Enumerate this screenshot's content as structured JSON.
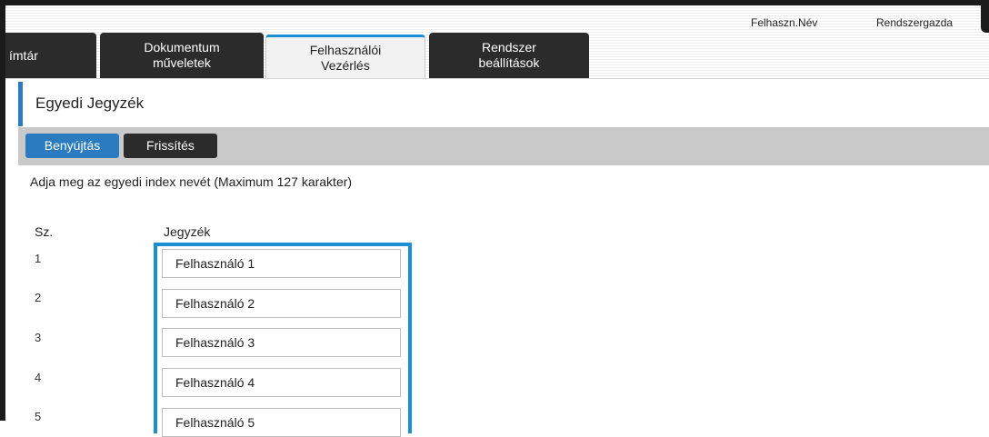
{
  "header": {
    "user_name_label": "Felhaszn.Név",
    "user_name_value": "Rendszergazda"
  },
  "tabs": [
    {
      "label_line1": "ímtár",
      "label_line2": ""
    },
    {
      "label_line1": "Dokumentum",
      "label_line2": "műveletek"
    },
    {
      "label_line1": "Felhasználói",
      "label_line2": "Vezérlés"
    },
    {
      "label_line1": "Rendszer",
      "label_line2": "beállítások"
    }
  ],
  "active_tab": "Felhasználói Vezérlés",
  "page": {
    "title": "Egyedi Jegyzék",
    "submit_label": "Benyújtás",
    "refresh_label": "Frissítés",
    "instruction": "Adja meg az egyedi index nevét  (Maximum 127 karakter)",
    "column_no": "Sz.",
    "column_name": "Jegyzék"
  },
  "rows": [
    {
      "no": "1",
      "value": "Felhasználó 1"
    },
    {
      "no": "2",
      "value": "Felhasználó 2"
    },
    {
      "no": "3",
      "value": "Felhasználó 3"
    },
    {
      "no": "4",
      "value": "Felhasználó 4"
    },
    {
      "no": "5",
      "value": "Felhasználó 5"
    }
  ],
  "colors": {
    "accent": "#1e8ed2",
    "title_accent": "#2a7bc0",
    "tab_dark": "#2b2b2b",
    "button_bar": "#c9c9c9"
  }
}
